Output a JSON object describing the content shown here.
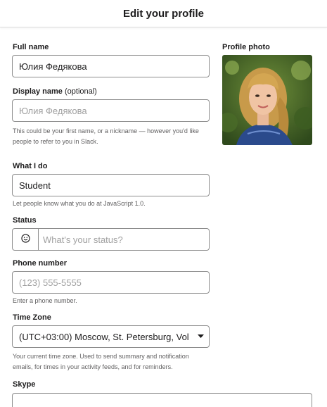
{
  "header": {
    "title": "Edit your profile"
  },
  "form": {
    "full_name": {
      "label": "Full name",
      "value": "Юлия Федякова"
    },
    "display_name": {
      "label": "Display name",
      "label_suffix": "(optional)",
      "placeholder": "Юлия Федякова",
      "hint_line1": "This could be your first name, or a nickname — however you'd like",
      "hint_line2": "people to refer to you in Slack."
    },
    "what_i_do": {
      "label": "What I do",
      "value": "Student",
      "hint": "Let people know what you do at JavaScript 1.0."
    },
    "status": {
      "label": "Status",
      "placeholder": "What's your status?",
      "icon": "smiley-icon"
    },
    "phone": {
      "label": "Phone number",
      "placeholder": "(123) 555-5555",
      "hint": "Enter a phone number."
    },
    "time_zone": {
      "label": "Time Zone",
      "value": "(UTC+03:00) Moscow, St. Petersburg, Vol",
      "hint_line1": "Your current time zone. Used to send summary and notification",
      "hint_line2": "emails, for times in your activity feeds, and for reminders."
    },
    "skype": {
      "label": "Skype"
    }
  },
  "photo": {
    "label": "Profile photo"
  },
  "colors": {
    "text": "#1d1c1d",
    "hint": "#616061",
    "border": "#8d8d8d",
    "placeholder": "#a0a0a0"
  }
}
